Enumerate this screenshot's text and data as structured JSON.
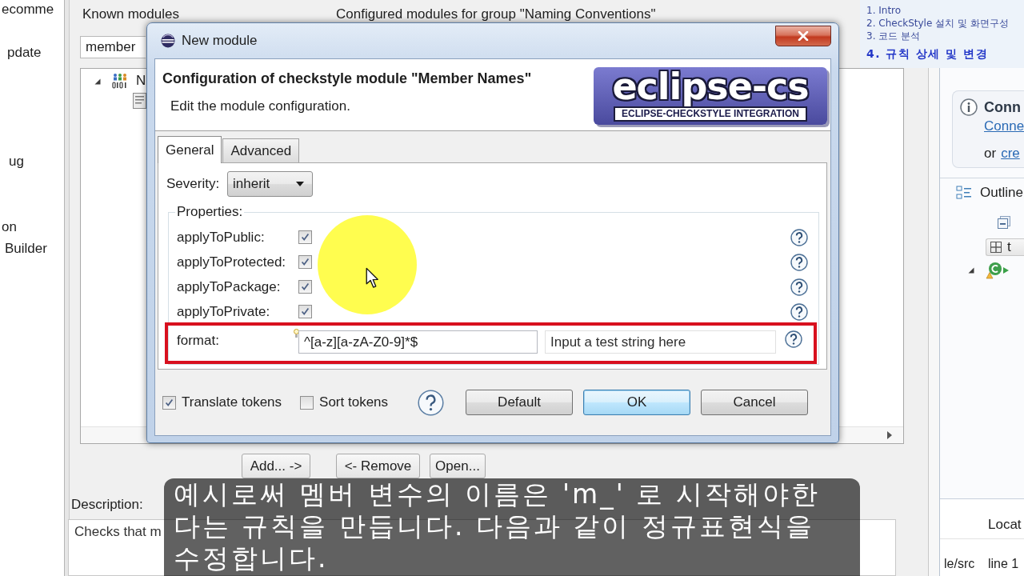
{
  "preferences_tree": {
    "items": [
      "ecomme",
      "pdate",
      "ug",
      "on",
      "Builder"
    ]
  },
  "main_panel": {
    "known_label": "Known modules",
    "configured_label": "Configured modules for group \"Naming Conventions\"",
    "filter_value": "member",
    "tree": [
      {
        "label": "N",
        "expanded": true
      }
    ],
    "buttons": [
      "Add... ->",
      "<- Remove",
      "Open..."
    ],
    "description_label": "Description:",
    "description": "Checks that m"
  },
  "dialog": {
    "title": "New module",
    "header": {
      "title": "Configuration of checkstyle module \"Member Names\"",
      "subtitle": "Edit the module configuration.",
      "logo": {
        "wordmark": "eclipse-cs",
        "tagline": "ECLIPSE-CHECKSTYLE INTEGRATION"
      }
    },
    "tabs": [
      {
        "label": "General",
        "selected": true
      },
      {
        "label": "Advanced",
        "selected": false
      }
    ],
    "severity": {
      "label": "Severity:",
      "value": "inherit"
    },
    "properties": {
      "title": "Properties:",
      "rows": [
        {
          "kind": "checkbox",
          "label": "applyToPublic:",
          "checked": true,
          "highlighted": false
        },
        {
          "kind": "checkbox",
          "label": "applyToProtected:",
          "checked": true,
          "highlighted": false
        },
        {
          "kind": "checkbox",
          "label": "applyToPackage:",
          "checked": true,
          "highlighted": false
        },
        {
          "kind": "checkbox",
          "label": "applyToPrivate:",
          "checked": true,
          "highlighted": false
        },
        {
          "kind": "regex",
          "label": "format:",
          "value": "^[a-z][a-zA-Z0-9]*$",
          "test_field": {
            "placeholder": "Input a test string here"
          },
          "highlighted": true
        }
      ]
    },
    "options": [
      {
        "label": "Translate tokens",
        "checked": true
      },
      {
        "label": "Sort tokens",
        "checked": false
      }
    ],
    "buttons": [
      {
        "label": "Default",
        "default": false
      },
      {
        "label": "OK",
        "default": true
      },
      {
        "label": "Cancel",
        "default": false
      }
    ]
  },
  "right_panel": {
    "info_card": {
      "title": "Conn",
      "link": "Conne",
      "text": "or",
      "link_2": "cre"
    },
    "outline": {
      "title": "Outline",
      "button_label": "t"
    },
    "table": {
      "header": "Locat",
      "row": [
        "le/src",
        "line 1"
      ]
    }
  },
  "chapters": [
    {
      "label": "1. Intro",
      "selected": false
    },
    {
      "label": "2. CheckStyle 설치 및 화면구성",
      "selected": false
    },
    {
      "label": "3. 코드 분석",
      "selected": false
    },
    {
      "label": "4. 규칙 상세 및 변경",
      "selected": true
    }
  ],
  "subtitle": {
    "text": "예시로써 멤버 변수의 이름은 'm_' 로 시작해야한다는 규칙을 만듭니다. 다음과 같이 정규표현식을 수정합니다."
  }
}
